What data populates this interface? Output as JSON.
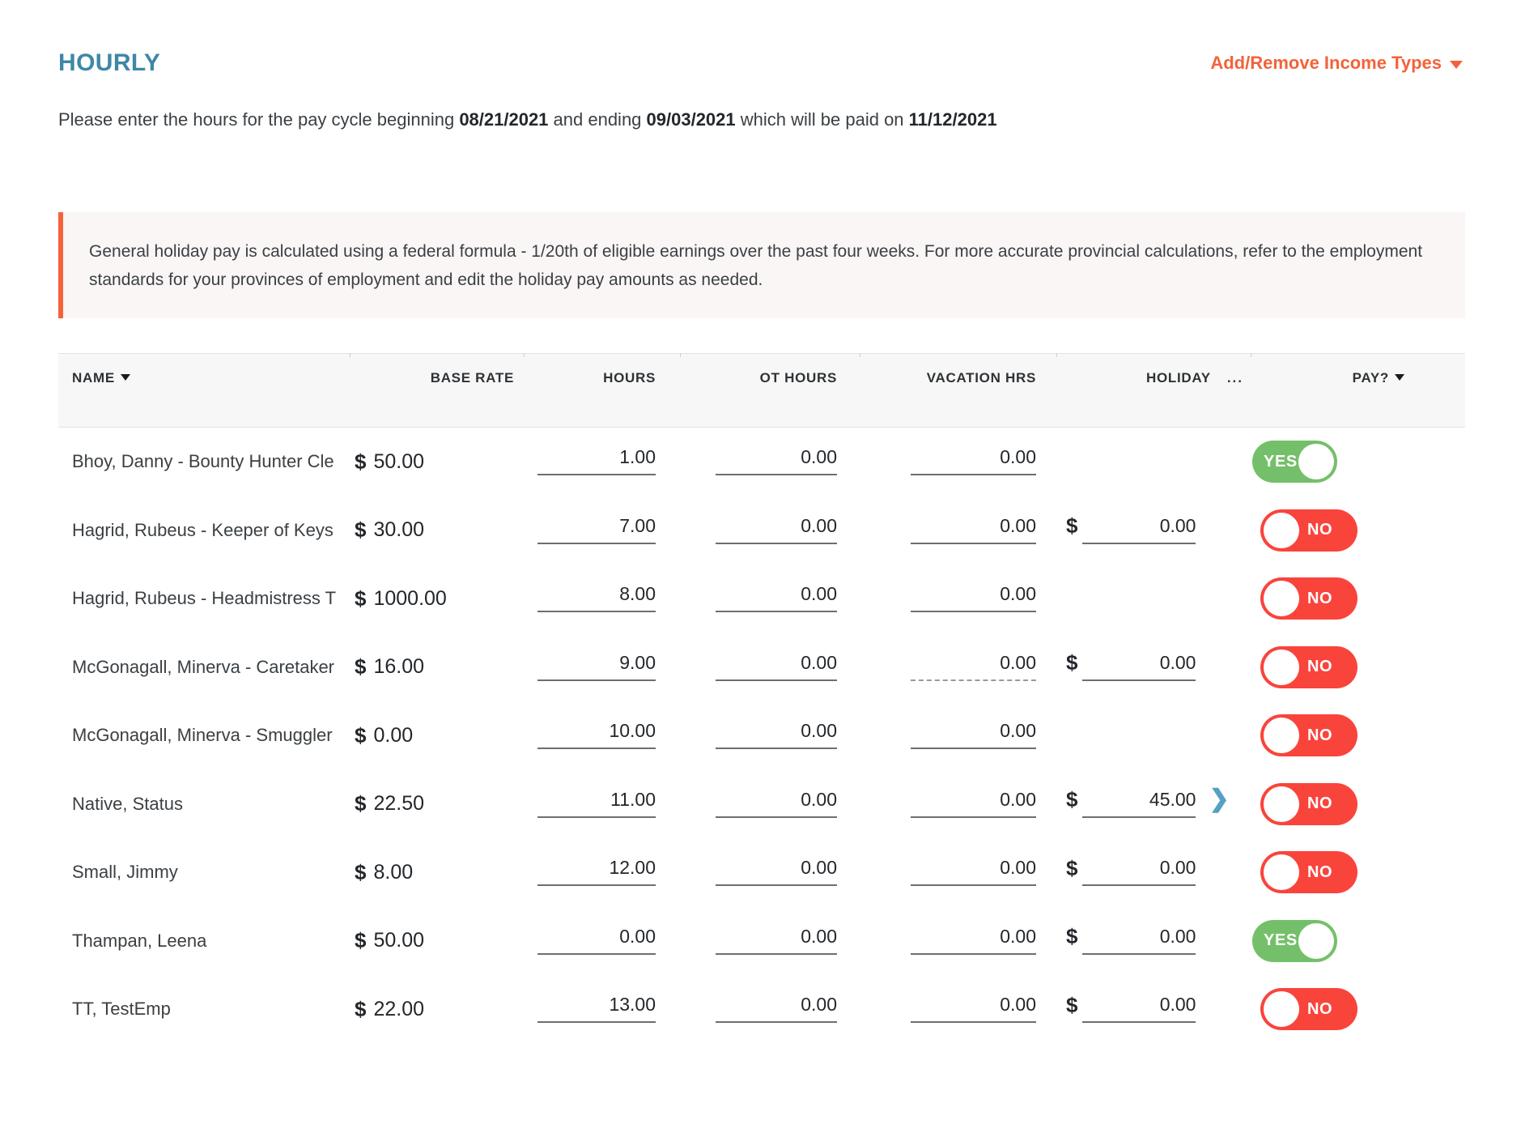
{
  "header": {
    "title": "HOURLY",
    "add_remove_label": "Add/Remove Income Types",
    "caret_icon": "chevron-down-icon"
  },
  "subtitle": {
    "part1": "Please enter the hours for the pay cycle beginning ",
    "begin_date": "08/21/2021",
    "part2": " and ending ",
    "end_date": "09/03/2021",
    "part3": " which will be paid on ",
    "pay_date": "11/12/2021"
  },
  "banner": {
    "text": "General holiday pay is calculated using a federal formula - 1/20th of eligible earnings over the past four weeks. For more accurate provincial calculations, refer to the employment standards for your provinces of employment and edit the holiday pay amounts as needed."
  },
  "table": {
    "columns": {
      "name": "NAME",
      "base_rate": "BASE RATE",
      "hours": "HOURS",
      "ot_hours": "OT HOURS",
      "vacation_hrs": "VACATION HRS",
      "holiday": "HOLIDAY",
      "holiday_overflow": "...",
      "pay": "PAY?"
    },
    "rows": [
      {
        "name": "Bhoy, Danny - Bounty Hunter Cle",
        "currency": "$",
        "base_rate": "50.00",
        "hours": "1.00",
        "ot_hours": "0.00",
        "vacation_hrs": "0.00",
        "vacation_disabled": false,
        "holiday": null,
        "holiday_expand": false,
        "pay": "YES"
      },
      {
        "name": "Hagrid, Rubeus - Keeper of Keys",
        "currency": "$",
        "base_rate": "30.00",
        "hours": "7.00",
        "ot_hours": "0.00",
        "vacation_hrs": "0.00",
        "vacation_disabled": false,
        "holiday": "0.00",
        "holiday_expand": false,
        "pay": "NO"
      },
      {
        "name": "Hagrid, Rubeus - Headmistress T",
        "currency": "$",
        "base_rate": "1000.00",
        "hours": "8.00",
        "ot_hours": "0.00",
        "vacation_hrs": "0.00",
        "vacation_disabled": false,
        "holiday": null,
        "holiday_expand": false,
        "pay": "NO"
      },
      {
        "name": "McGonagall, Minerva - Caretaker",
        "currency": "$",
        "base_rate": "16.00",
        "hours": "9.00",
        "ot_hours": "0.00",
        "vacation_hrs": "0.00",
        "vacation_disabled": true,
        "holiday": "0.00",
        "holiday_expand": false,
        "pay": "NO"
      },
      {
        "name": "McGonagall, Minerva - Smuggler",
        "currency": "$",
        "base_rate": "0.00",
        "hours": "10.00",
        "ot_hours": "0.00",
        "vacation_hrs": "0.00",
        "vacation_disabled": false,
        "holiday": null,
        "holiday_expand": false,
        "pay": "NO"
      },
      {
        "name": "Native, Status",
        "currency": "$",
        "base_rate": "22.50",
        "hours": "11.00",
        "ot_hours": "0.00",
        "vacation_hrs": "0.00",
        "vacation_disabled": false,
        "holiday": "45.00",
        "holiday_expand": true,
        "pay": "NO"
      },
      {
        "name": "Small, Jimmy",
        "currency": "$",
        "base_rate": "8.00",
        "hours": "12.00",
        "ot_hours": "0.00",
        "vacation_hrs": "0.00",
        "vacation_disabled": false,
        "holiday": "0.00",
        "holiday_expand": false,
        "pay": "NO"
      },
      {
        "name": "Thampan, Leena",
        "currency": "$",
        "base_rate": "50.00",
        "hours": "0.00",
        "ot_hours": "0.00",
        "vacation_hrs": "0.00",
        "vacation_disabled": false,
        "holiday": "0.00",
        "holiday_expand": false,
        "pay": "YES"
      },
      {
        "name": "TT, TestEmp",
        "currency": "$",
        "base_rate": "22.00",
        "hours": "13.00",
        "ot_hours": "0.00",
        "vacation_hrs": "0.00",
        "vacation_disabled": false,
        "holiday": "0.00",
        "holiday_expand": false,
        "pay": "NO"
      }
    ]
  },
  "colors": {
    "title": "#3f87a6",
    "accent_orange": "#f4623a",
    "toggle_on": "#74c06a",
    "toggle_off": "#f9443c",
    "chevron_blue": "#55a0c4"
  }
}
